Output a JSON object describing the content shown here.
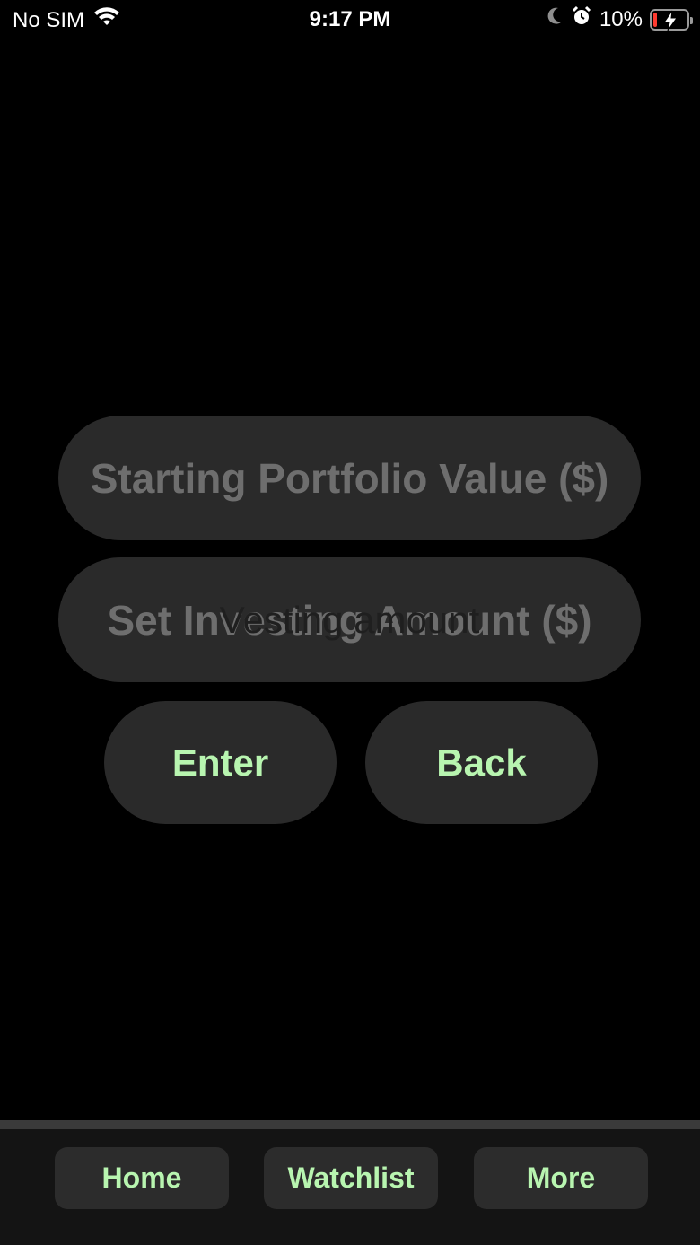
{
  "status_bar": {
    "carrier": "No SIM",
    "time": "9:17 PM",
    "battery_percent": "10%",
    "battery_level": 0.1,
    "icons": [
      "wifi-icon",
      "moon-icon",
      "alarm-icon",
      "battery-charging-icon"
    ]
  },
  "form": {
    "starting_value_placeholder": "Starting Portfolio Value ($)",
    "investing_amount_placeholder": "Set Investing Amount ($)",
    "investing_overlay": "Vesting amount"
  },
  "buttons": {
    "enter": "Enter",
    "back": "Back"
  },
  "tab_bar": {
    "home": "Home",
    "watchlist": "Watchlist",
    "more": "More"
  },
  "colors": {
    "background": "#000000",
    "accent_text": "#b8f5b0",
    "control_bg": "#2a2a2a",
    "placeholder": "#6e6e6e"
  }
}
